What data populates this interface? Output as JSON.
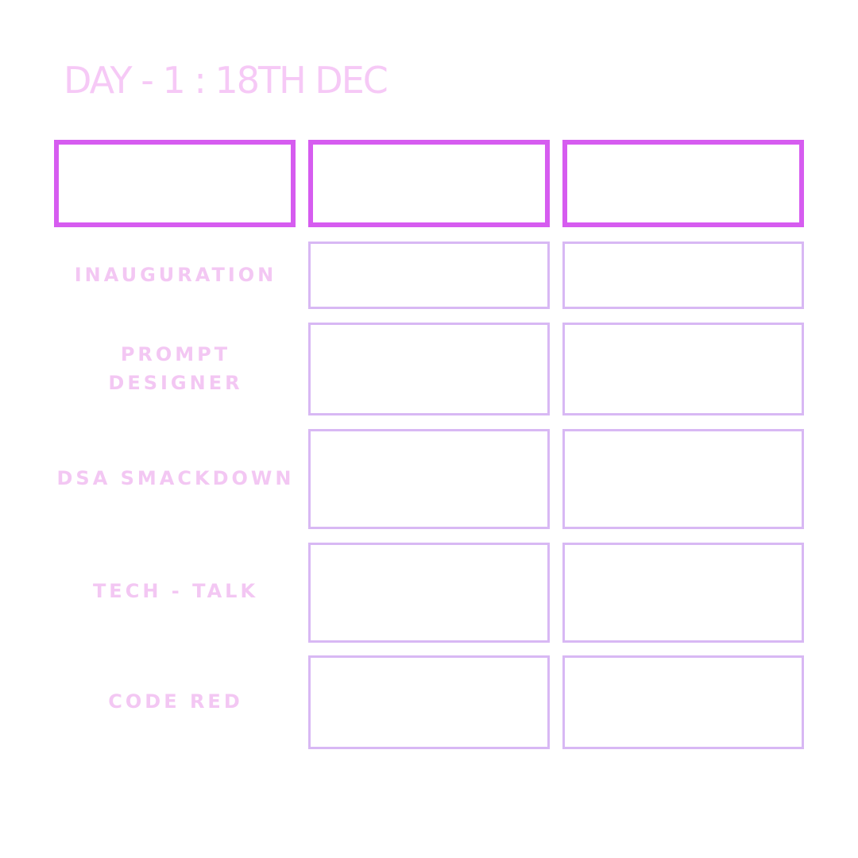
{
  "title": "DAY - 1 : 18TH DEC",
  "colors": {
    "title": "#f6c9f6",
    "header_border": "#d65cf0",
    "cell_border": "#d8b8f4",
    "label": "#f3c7f3",
    "background": "#ffffff"
  },
  "rows": [
    {
      "label": "INAUGURATION"
    },
    {
      "label": "PROMPT\nDESIGNER"
    },
    {
      "label": "DSA SMACKDOWN"
    },
    {
      "label": "TECH - TALK"
    },
    {
      "label": "CODE RED"
    }
  ]
}
